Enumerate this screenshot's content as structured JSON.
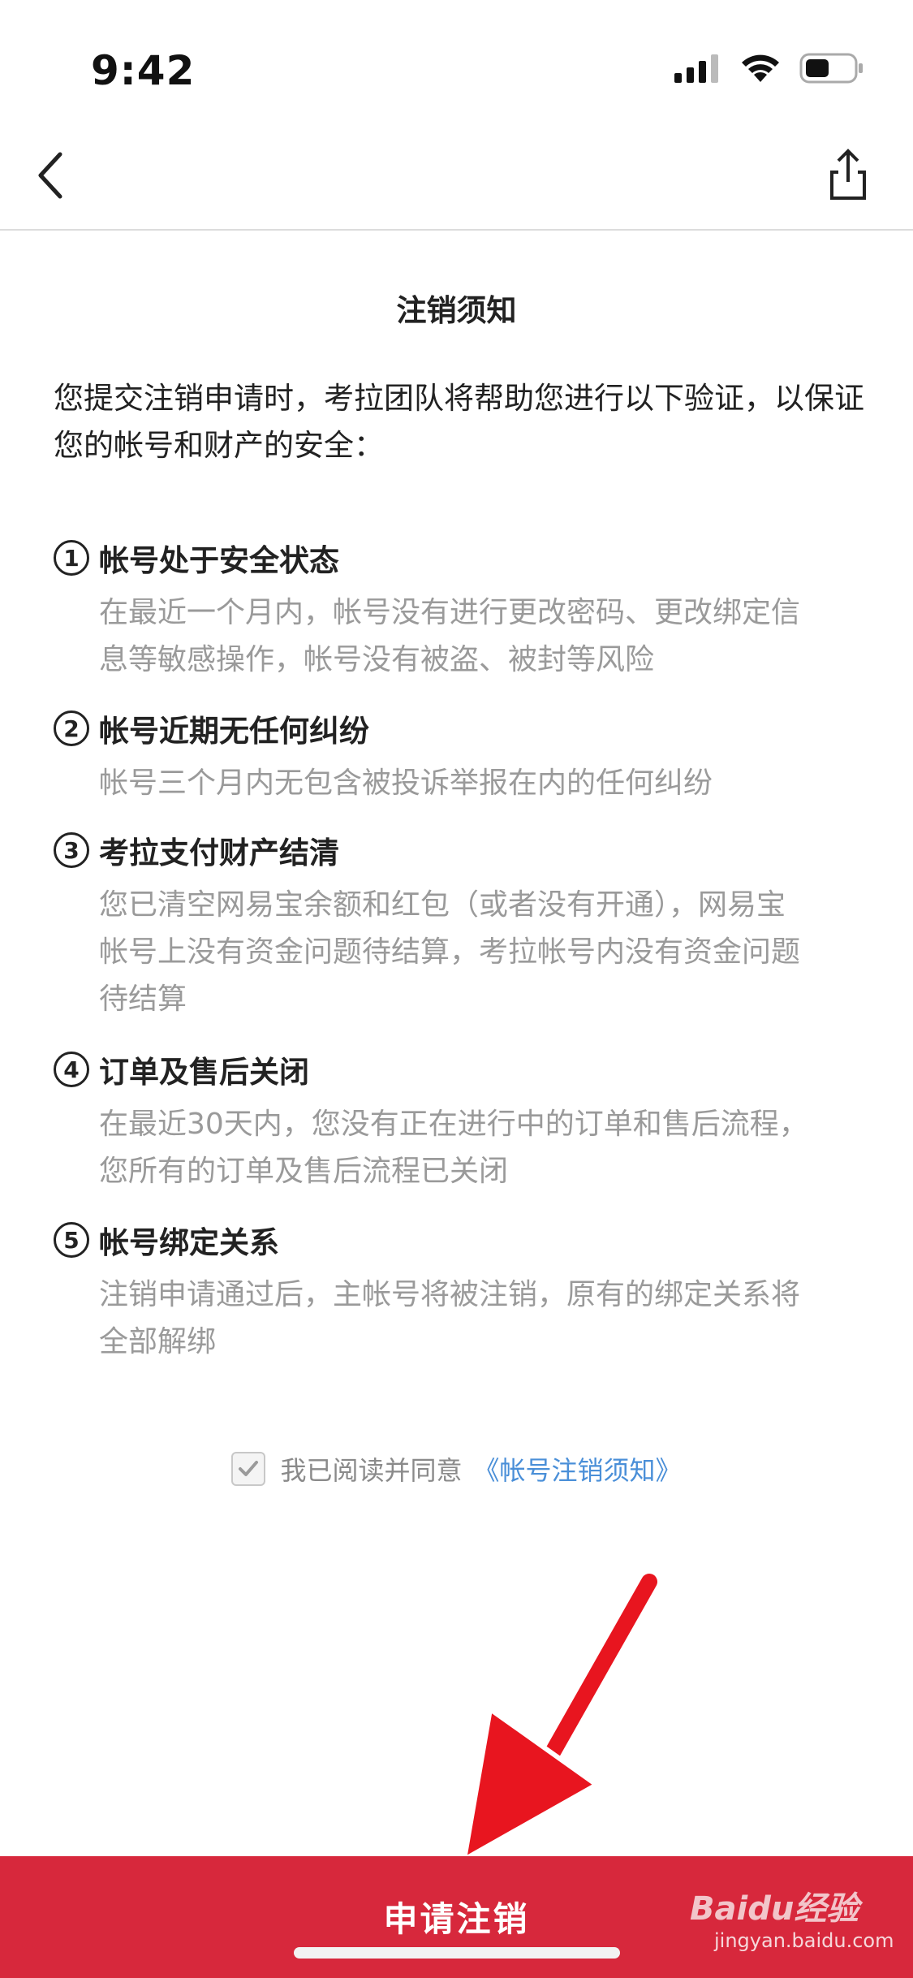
{
  "status_bar": {
    "time": "9:42"
  },
  "page": {
    "title": "注销须知"
  },
  "intro": "您提交注销申请时，考拉团队将帮助您进行以下验证，以保证您的帐号和财产的安全：",
  "sections": [
    {
      "num": "1",
      "heading": "帐号处于安全状态",
      "lines": [
        "在最近一个月内，帐号没有进行更改密码、更改绑定信",
        "息等敏感操作，帐号没有被盗、被封等风险"
      ]
    },
    {
      "num": "2",
      "heading": "帐号近期无任何纠纷",
      "lines": [
        "帐号三个月内无包含被投诉举报在内的任何纠纷"
      ]
    },
    {
      "num": "3",
      "heading": "考拉支付财产结清",
      "lines": [
        "您已清空网易宝余额和红包（或者没有开通），网易宝",
        "帐号上没有资金问题待结算，考拉帐号内没有资金问题",
        "待结算"
      ]
    },
    {
      "num": "4",
      "heading": "订单及售后关闭",
      "lines": [
        "在最近30天内，您没有正在进行中的订单和售后流程，",
        "您所有的订单及售后流程已关闭"
      ]
    },
    {
      "num": "5",
      "heading": "帐号绑定关系",
      "lines": [
        "注销申请通过后，主帐号将被注销，原有的绑定关系将",
        "全部解绑"
      ]
    }
  ],
  "agreement": {
    "text": "我已阅读并同意",
    "link": "《帐号注销须知》",
    "checked": true
  },
  "footer": {
    "button_label": "申请注销"
  },
  "watermark": {
    "brand": "Bai",
    "brand2": "du",
    "product": "经验",
    "url": "jingyan.baidu.com"
  },
  "colors": {
    "accent": "#d7283c",
    "link": "#4a8fd8",
    "muted": "#9a9a9a"
  }
}
